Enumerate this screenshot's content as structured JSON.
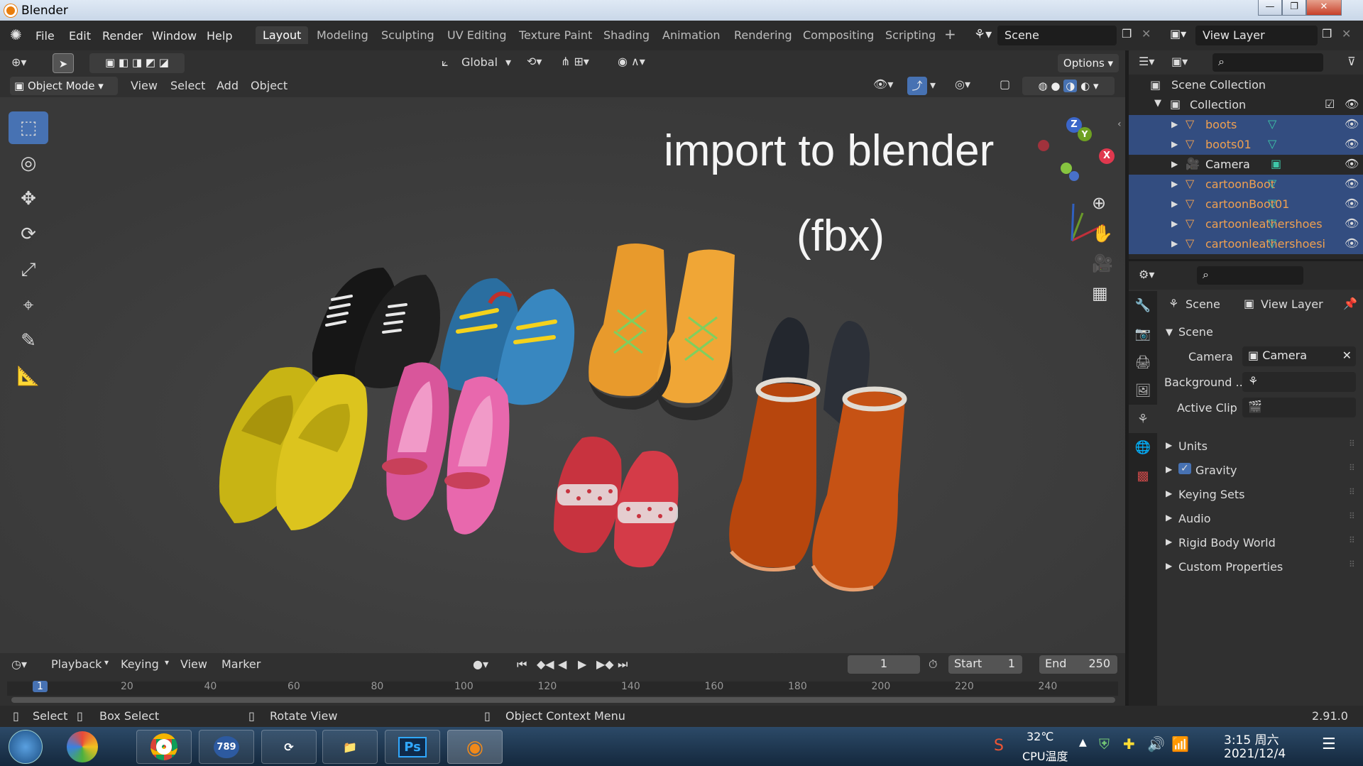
{
  "window": {
    "title": "Blender"
  },
  "menu": [
    "File",
    "Edit",
    "Render",
    "Window",
    "Help"
  ],
  "workspaces": [
    "Layout",
    "Modeling",
    "Sculpting",
    "UV Editing",
    "Texture Paint",
    "Shading",
    "Animation",
    "Rendering",
    "Compositing",
    "Scripting"
  ],
  "scene_field": "Scene",
  "view_layer_field": "View Layer",
  "toolbar": {
    "orientation": "Global",
    "options": "Options",
    "mode": "Object Mode",
    "view": "View",
    "select": "Select",
    "add": "Add",
    "object": "Object"
  },
  "viewport": {
    "overlay_title": "import to blender",
    "overlay_sub": "(fbx)"
  },
  "outliner": {
    "scene_collection": "Scene Collection",
    "collection": "Collection",
    "items": [
      {
        "label": "boots",
        "selected": true
      },
      {
        "label": "boots01",
        "selected": true
      },
      {
        "label": "Camera",
        "selected": false
      },
      {
        "label": "cartoonBoot",
        "selected": true
      },
      {
        "label": "cartoonBoot01",
        "selected": true
      },
      {
        "label": "cartoonleathershoes",
        "selected": true
      },
      {
        "label": "cartoonleathershoesi",
        "selected": true
      }
    ]
  },
  "properties": {
    "scene_tab": "Scene",
    "view_layer_tab": "View Layer",
    "section_scene": "Scene",
    "camera_label": "Camera",
    "camera_value": "Camera",
    "background_label": "Background ...",
    "active_clip_label": "Active Clip",
    "panels": [
      "Units",
      "Gravity",
      "Keying Sets",
      "Audio",
      "Rigid Body World",
      "Custom Properties"
    ]
  },
  "timeline": {
    "playback": "Playback",
    "keying": "Keying",
    "view": "View",
    "marker": "Marker",
    "current_frame": "1",
    "start_label": "Start",
    "start_value": "1",
    "end_label": "End",
    "end_value": "250",
    "ruler": [
      "1",
      "20",
      "40",
      "60",
      "80",
      "100",
      "120",
      "140",
      "160",
      "180",
      "200",
      "220",
      "240"
    ]
  },
  "status": {
    "select": "Select",
    "box_select": "Box Select",
    "rotate_view": "Rotate View",
    "context_menu": "Object Context Menu",
    "version": "2.91.0"
  },
  "taskbar": {
    "temp": "32℃",
    "temp_label": "CPU温度",
    "time": "3:15 周六",
    "date": "2021/12/4",
    "ps_label": "Ps",
    "badge": "789"
  },
  "colors": {
    "accent": "#4772b3",
    "selected_row": "#334d80",
    "object_text": "#f0a050"
  }
}
